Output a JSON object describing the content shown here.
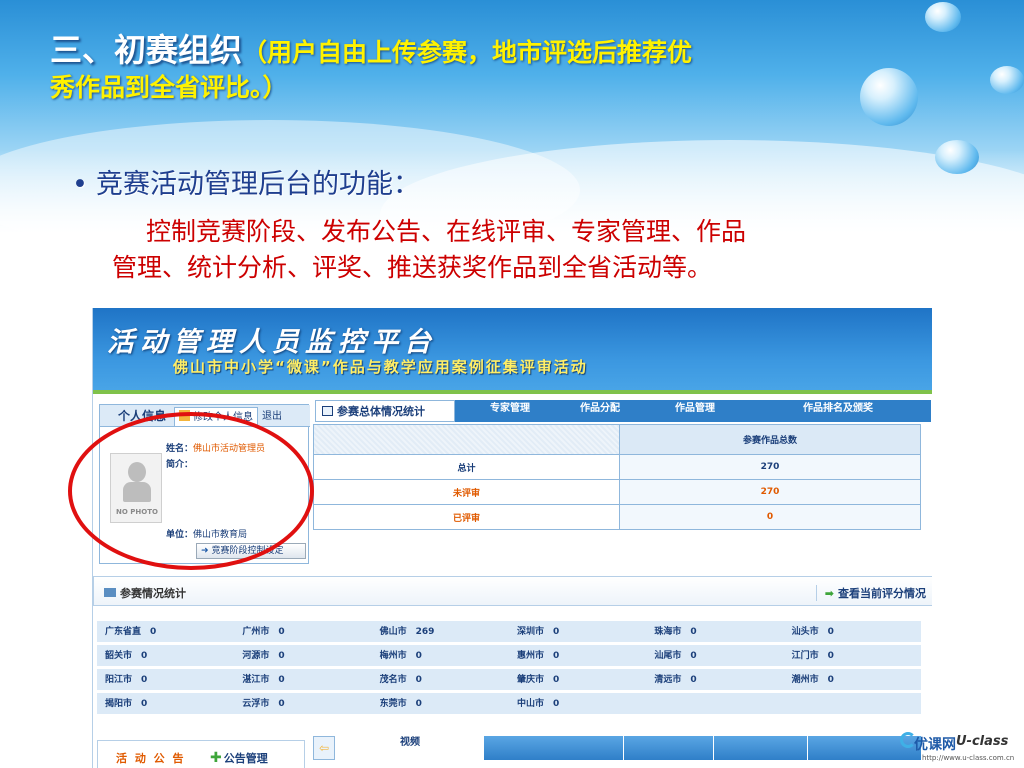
{
  "slide": {
    "title_main": "三、初赛组织",
    "title_sub_line1": "（用户自由上传参赛，地市评选后推荐优",
    "title_sub_line2": "秀作品到全省评比。）",
    "bullet": "竞赛活动管理后台的功能：",
    "desc_line1": "控制竞赛阶段、发布公告、在线评审、专家管理、作品",
    "desc_line2": "管理、统计分析、评奖、推送获奖作品到全省活动等。"
  },
  "platform": {
    "banner_title": "活动管理人员监控平台",
    "banner_sub": "佛山市中小学“微课”作品与教学应用案例征集评审活动"
  },
  "info_panel": {
    "tab_label": "个人信息",
    "edit_tab": "修改个人信息",
    "logout_tab": "退出",
    "avatar_text": "NO PHOTO",
    "name_label": "姓名：",
    "name_value": "佛山市活动管理员",
    "intro_label": "简介：",
    "unit_label": "单位：",
    "unit_value": "佛山市教育局",
    "stage_button": "竞赛阶段控制设定"
  },
  "menu": {
    "active": "参赛总体情况统计",
    "items": [
      "专家管理",
      "作品分配",
      "作品管理",
      "作品排名及颁奖"
    ]
  },
  "stats": {
    "header": "参赛作品总数",
    "rows": [
      {
        "label": "总计",
        "value": "270",
        "style": "blue"
      },
      {
        "label": "未评审",
        "value": "270",
        "style": "orange"
      },
      {
        "label": "已评审",
        "value": "0",
        "style": "orange"
      }
    ]
  },
  "participation": {
    "title": "参赛情况统计",
    "link": "查看当前评分情况",
    "cities": [
      [
        "广东省直　0",
        "广州市　0",
        "佛山市　269",
        "深圳市　0",
        "珠海市　0",
        "汕头市　0"
      ],
      [
        "韶关市　0",
        "河源市　0",
        "梅州市　0",
        "惠州市　0",
        "汕尾市　0",
        "江门市　0"
      ],
      [
        "阳江市　0",
        "湛江市　0",
        "茂名市　0",
        "肇庆市　0",
        "清远市　0",
        "潮州市　0"
      ],
      [
        "揭阳市　0",
        "云浮市　0",
        "东莞市　0",
        "中山市　0",
        "",
        ""
      ]
    ]
  },
  "footer": {
    "notice": "活 动 公 告",
    "notice_manage": "公告管理",
    "video_tab": "视频"
  },
  "logo": {
    "cn": "优课网",
    "en": "U-class",
    "url": "http://www.u-class.com.cn"
  }
}
